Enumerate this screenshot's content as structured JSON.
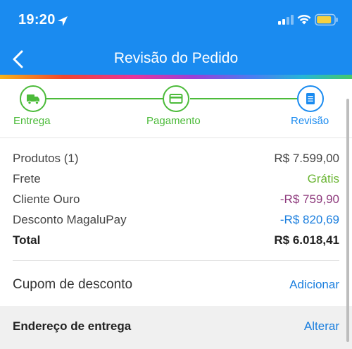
{
  "status_bar": {
    "time": "19:20",
    "icons": [
      "location-arrow-icon",
      "signal-icon",
      "wifi-icon",
      "battery-icon"
    ],
    "battery_color": "#f5d040"
  },
  "nav": {
    "title": "Revisão do Pedido",
    "back_icon": "chevron-left-icon"
  },
  "colors": {
    "header_blue": "#1a8bf0",
    "step_green": "#4cbb3a",
    "free_green": "#6ab533",
    "ouro_purple": "#8e3a7d",
    "magalupay_blue": "#1a7ede"
  },
  "steps": [
    {
      "label": "Entrega",
      "icon": "truck-icon",
      "state": "completed"
    },
    {
      "label": "Pagamento",
      "icon": "card-icon",
      "state": "completed"
    },
    {
      "label": "Revisão",
      "icon": "document-icon",
      "state": "current"
    }
  ],
  "summary": [
    {
      "label": "Produtos (1)",
      "value": "R$ 7.599,00"
    },
    {
      "label": "Frete",
      "value": "Grátis"
    },
    {
      "label": "Cliente Ouro",
      "value": "-R$ 759,90"
    },
    {
      "label": "Desconto MagaluPay",
      "value": "-R$ 820,69"
    },
    {
      "label": "Total",
      "value": "R$ 6.018,41"
    }
  ],
  "coupon": {
    "label": "Cupom de desconto",
    "action": "Adicionar"
  },
  "address": {
    "label": "Endereço de entrega",
    "action": "Alterar"
  }
}
